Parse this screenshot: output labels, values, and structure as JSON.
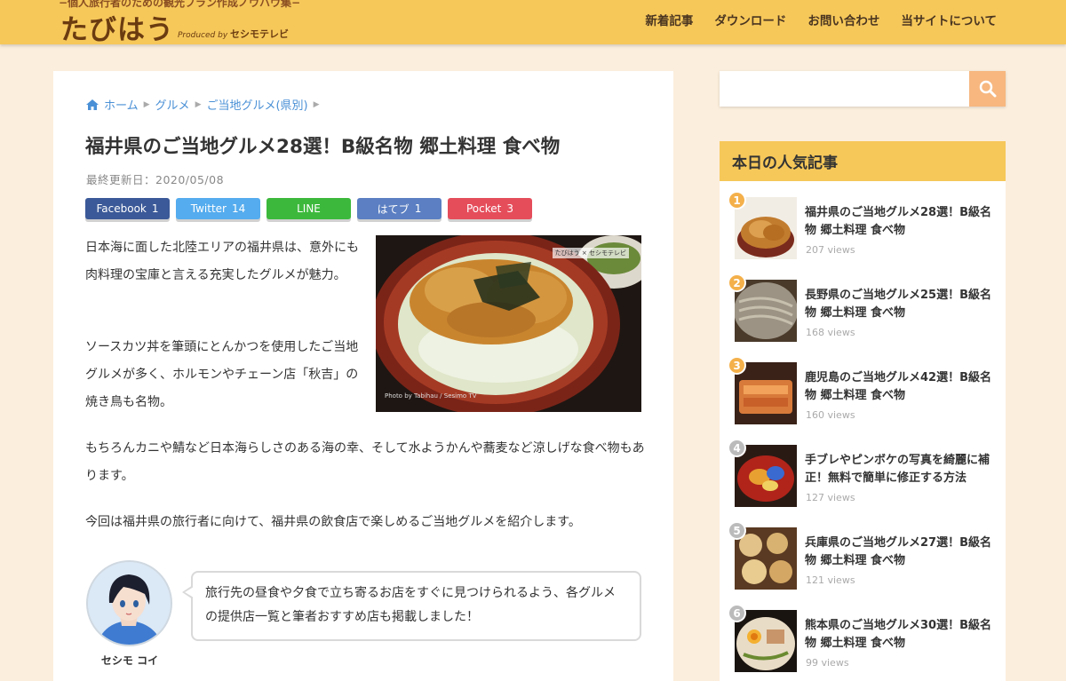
{
  "header": {
    "tagline": "−個人旅行者のための観光プラン作成ノウハウ集−",
    "logo": "たびはう",
    "produced_by_prefix": "Produced by",
    "produced_by_name": "セシモテレビ",
    "nav": [
      "新着記事",
      "ダウンロード",
      "お問い合わせ",
      "当サイトについて"
    ]
  },
  "breadcrumb": [
    "ホーム",
    "グルメ",
    "ご当地グルメ(県別)"
  ],
  "article": {
    "title": "福井県のご当地グルメ28選！B級名物 郷土料理 食べ物",
    "updated": "最終更新日：2020/05/08",
    "shares": [
      {
        "label": "Facebook",
        "count": "1"
      },
      {
        "label": "Twitter",
        "count": "14"
      },
      {
        "label": "LINE",
        "count": ""
      },
      {
        "label": "はてブ",
        "count": "1"
      },
      {
        "label": "Pocket",
        "count": "3"
      }
    ],
    "paragraphs": [
      "日本海に面した北陸エリアの福井県は、意外にも肉料理の宝庫と言える充実したグルメが魅力。",
      "ソースカツ丼を筆頭にとんかつを使用したご当地グルメが多く、ホルモンやチェーン店「秋吉」の焼き鳥も名物。",
      "もちろんカニや鯖など日本海らしさのある海の幸、そして水ようかんや蕎麦など涼しげな食べ物もあります。",
      "今回は福井県の旅行者に向けて、福井県の飲食店で楽しめるご当地グルメを紹介します。"
    ],
    "photo_credit": "Photo by Tabihau / Sesimo TV",
    "photo_tag": "たびはう × セシモテレビ",
    "balloon_name": "セシモ コイ",
    "balloon_text": "旅行先の昼食や夕食で立ち寄るお店をすぐに見つけられるよう、各グルメの提供店一覧と筆者おすすめ店も掲載しました！"
  },
  "sidebar": {
    "search_placeholder": "",
    "widget_title": "本日の人気記事",
    "popular": [
      {
        "rank": "1",
        "title": "福井県のご当地グルメ28選！B級名物 郷土料理 食べ物",
        "views": "207 views"
      },
      {
        "rank": "2",
        "title": "長野県のご当地グルメ25選！B級名物 郷土料理 食べ物",
        "views": "168 views"
      },
      {
        "rank": "3",
        "title": "鹿児島のご当地グルメ42選！B級名物 郷土料理 食べ物",
        "views": "160 views"
      },
      {
        "rank": "4",
        "title": "手ブレやピンボケの写真を綺麗に補正！無料で簡単に修正する方法",
        "views": "127 views"
      },
      {
        "rank": "5",
        "title": "兵庫県のご当地グルメ27選！B級名物 郷土料理 食べ物",
        "views": "121 views"
      },
      {
        "rank": "6",
        "title": "熊本県のご当地グルメ30選！B級名物 郷土料理 食べ物",
        "views": "99 views"
      }
    ]
  }
}
